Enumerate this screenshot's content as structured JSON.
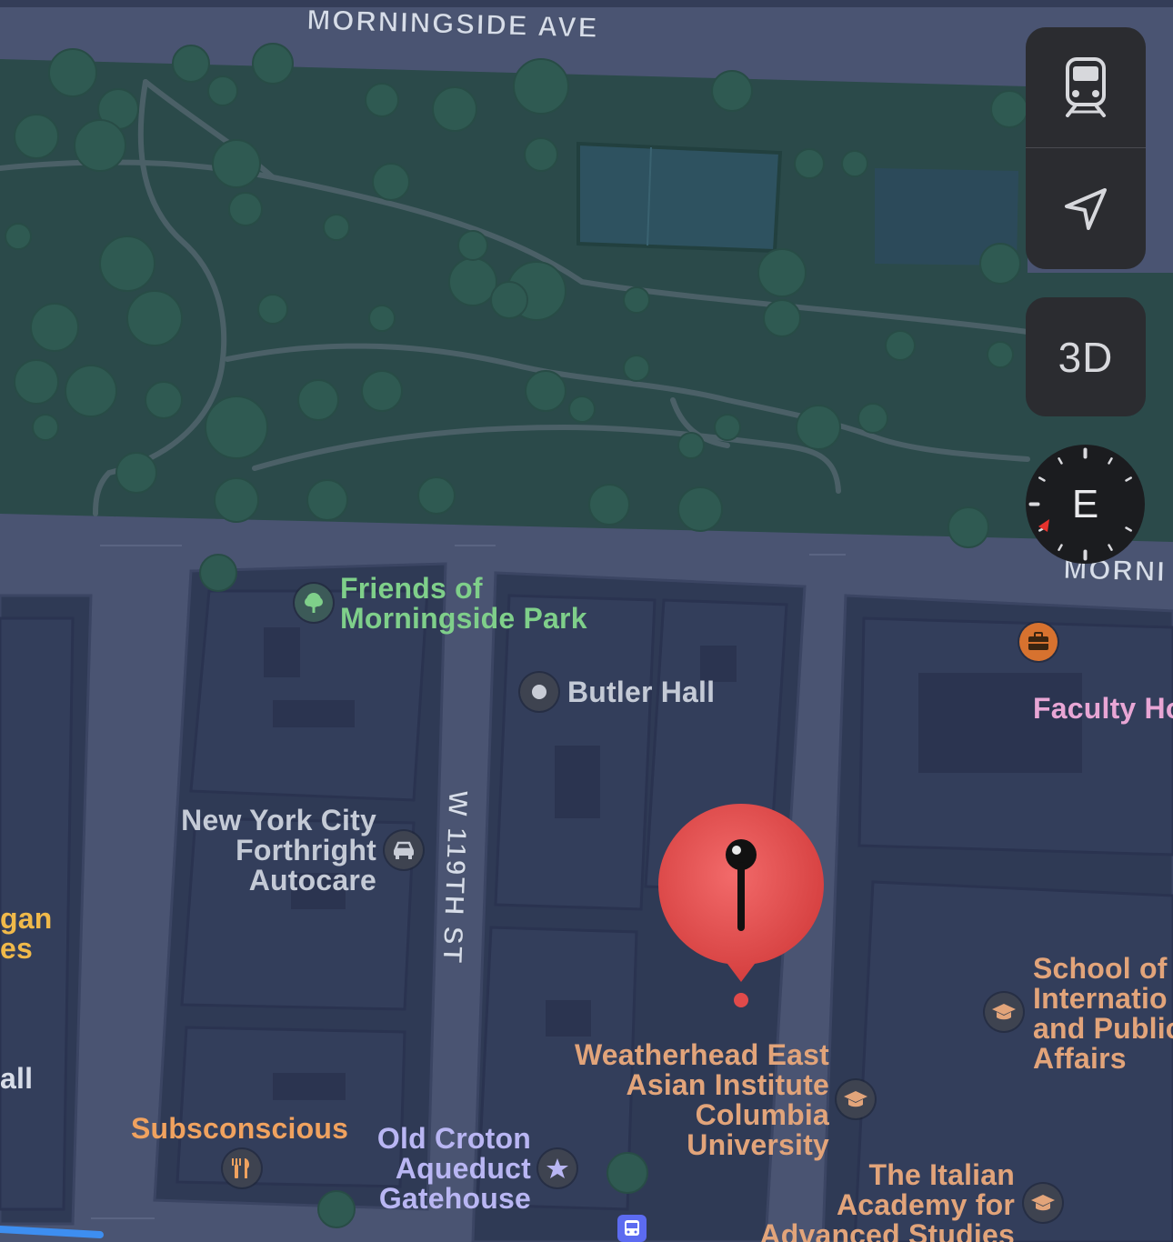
{
  "map": {
    "streets": {
      "top": "MORNINGSIDE AVE",
      "right_partial": "MORNI",
      "vertical": "W 119TH ST"
    },
    "pois": [
      {
        "key": "friends",
        "line1": "Friends of",
        "line2": "Morningside Park",
        "icon": "tree-icon"
      },
      {
        "key": "butler",
        "label": "Butler Hall",
        "icon": "dot-icon"
      },
      {
        "key": "faculty",
        "label": "Faculty Ho",
        "icon": "briefcase-icon"
      },
      {
        "key": "autocare",
        "line1": "New York City",
        "line2": "Forthright",
        "line3": "Autocare",
        "icon": "car-icon"
      },
      {
        "key": "sipa",
        "line1": "School of",
        "line2": "Internatio",
        "line3": "and Public",
        "line4": "Affairs",
        "icon": "graduation-cap-icon"
      },
      {
        "key": "weatherhead",
        "line1": "Weatherhead East",
        "line2": "Asian Institute",
        "line3": "Columbia",
        "line4": "University",
        "icon": "graduation-cap-icon"
      },
      {
        "key": "italian",
        "line1": "The Italian",
        "line2": "Academy for",
        "line3": "Advanced Studies",
        "icon": "graduation-cap-icon"
      },
      {
        "key": "subsconscious",
        "label": "Subsconscious",
        "icon": "fork-knife-icon"
      },
      {
        "key": "croton",
        "line1": "Old Croton",
        "line2": "Aqueduct",
        "line3": "Gatehouse",
        "icon": "star-icon"
      },
      {
        "key": "edge1",
        "line1": "gan",
        "line2": "es"
      },
      {
        "key": "edge2",
        "label": "all"
      }
    ],
    "dropped_pin": {
      "icon": "pushpin-icon",
      "color": "#e04a4a"
    }
  },
  "controls": {
    "transit_icon": "train-icon",
    "location_icon": "location-arrow-icon",
    "view_3d_label": "3D",
    "compass_heading": "E"
  },
  "colors": {
    "park": "#2a4a4a",
    "blocks": "#2f3a55",
    "streets": "#4a5472",
    "park_label": "#7fcf8a",
    "pin": "#e04a4a"
  }
}
